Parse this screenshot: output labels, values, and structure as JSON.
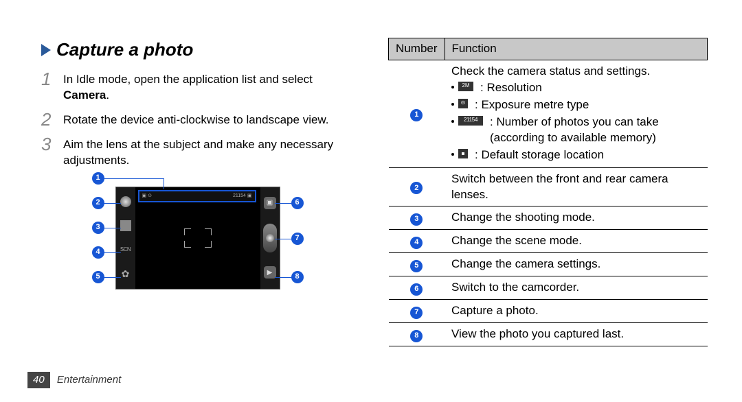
{
  "heading": "Capture a photo",
  "steps": [
    {
      "num": "1",
      "text_pre": "In Idle mode, open the application list and select ",
      "bold": "Camera",
      "text_post": "."
    },
    {
      "num": "2",
      "text_pre": "Rotate the device anti-clockwise to landscape view.",
      "bold": "",
      "text_post": ""
    },
    {
      "num": "3",
      "text_pre": "Aim the lens at the subject and make any necessary adjustments.",
      "bold": "",
      "text_post": ""
    }
  ],
  "diagram": {
    "left_callouts": [
      "1",
      "2",
      "3",
      "4",
      "5"
    ],
    "right_callouts": [
      "6",
      "7",
      "8"
    ],
    "statusbar_left": "▣ ⊙",
    "statusbar_right": "21154 ▣",
    "scn_label": "SCN"
  },
  "table": {
    "header_number": "Number",
    "header_function": "Function",
    "rows": [
      {
        "num": "1",
        "lead": "Check the camera status and settings.",
        "bullets": [
          {
            "icon": "res",
            "text": ": Resolution"
          },
          {
            "icon": "exp",
            "text": ": Exposure metre type"
          },
          {
            "icon": "count",
            "text": ": Number of photos you can take (according to available memory)"
          },
          {
            "icon": "store",
            "text": ": Default storage location"
          }
        ]
      },
      {
        "num": "2",
        "lead": "Switch between the front and rear camera lenses."
      },
      {
        "num": "3",
        "lead": "Change the shooting mode."
      },
      {
        "num": "4",
        "lead": "Change the scene mode."
      },
      {
        "num": "5",
        "lead": "Change the camera settings."
      },
      {
        "num": "6",
        "lead": "Switch to the camcorder."
      },
      {
        "num": "7",
        "lead": "Capture a photo."
      },
      {
        "num": "8",
        "lead": "View the photo you captured last."
      }
    ],
    "icon_labels": {
      "res": "2M",
      "exp": "⊙",
      "count": "21154",
      "store": ""
    }
  },
  "footer": {
    "page": "40",
    "section": "Entertainment"
  }
}
